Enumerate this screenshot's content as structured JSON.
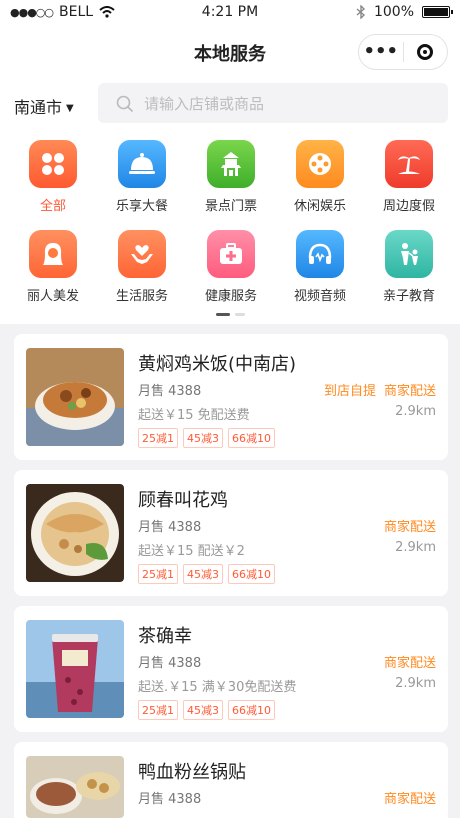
{
  "status": {
    "carrier": "BELL",
    "time": "4:21 PM",
    "battery": "100%"
  },
  "nav": {
    "title": "本地服务",
    "more_icon": "more-dots-icon",
    "close_icon": "target-icon"
  },
  "search": {
    "city": "南通市",
    "placeholder": "请输入店铺或商品"
  },
  "categories": [
    {
      "label": "全部",
      "icon": "grid-flower-icon",
      "color": "#ff6a3d",
      "active": true
    },
    {
      "label": "乐享大餐",
      "icon": "dish-cloche-icon",
      "color": "#2f9bf0"
    },
    {
      "label": "景点门票",
      "icon": "pavilion-icon",
      "color": "#55c23a"
    },
    {
      "label": "休闲娱乐",
      "icon": "film-reel-icon",
      "color": "#ff9a2a"
    },
    {
      "label": "周边度假",
      "icon": "palm-tree-icon",
      "color": "#ff4b3a"
    },
    {
      "label": "丽人美发",
      "icon": "woman-hair-icon",
      "color": "#ff7a3d"
    },
    {
      "label": "生活服务",
      "icon": "heart-hands-icon",
      "color": "#ff7a3d"
    },
    {
      "label": "健康服务",
      "icon": "medical-kit-icon",
      "color": "#ff6d8a"
    },
    {
      "label": "视频音频",
      "icon": "headphones-icon",
      "color": "#2f9bf0"
    },
    {
      "label": "亲子教育",
      "icon": "parent-child-icon",
      "color": "#3cc4b4"
    }
  ],
  "stores": [
    {
      "name": "黄焖鸡米饭(中南店)",
      "sales": "月售 4388",
      "fee": "起送￥15   免配送费",
      "delivery": [
        "到店自提",
        "商家配送"
      ],
      "distance": "2.9km",
      "tags": [
        "25减1",
        "45减3",
        "66减10"
      ]
    },
    {
      "name": "顾春叫花鸡",
      "sales": "月售 4388",
      "fee": "起送￥15   配送￥2",
      "delivery": [
        "商家配送"
      ],
      "distance": "2.9km",
      "tags": [
        "25减1",
        "45减3",
        "66减10"
      ]
    },
    {
      "name": "茶确幸",
      "sales": "月售 4388",
      "fee": "起送.￥15   满￥30免配送费",
      "delivery": [
        "商家配送"
      ],
      "distance": "2.9km",
      "tags": [
        "25减1",
        "45减3",
        "66减10"
      ]
    },
    {
      "name": "鸭血粉丝锅贴",
      "sales": "月售 4388",
      "fee": "",
      "delivery": [
        "商家配送"
      ],
      "distance": "",
      "tags": []
    }
  ]
}
